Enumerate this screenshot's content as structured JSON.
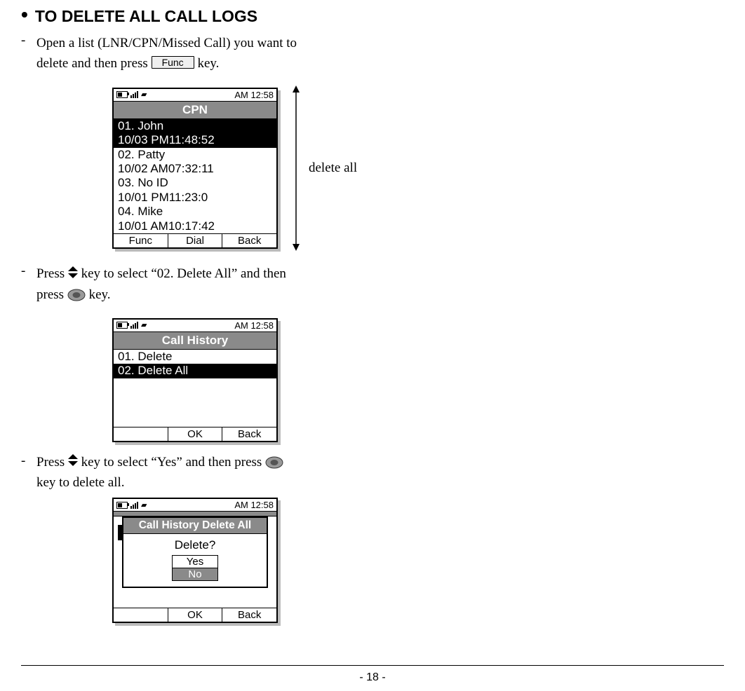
{
  "heading": "TO DELETE ALL CALL LOGS",
  "step1": {
    "line1": "Open a list (LNR/CPN/Missed Call) you want to",
    "line2a": "delete and then press",
    "func_key": "Func",
    "line2b": " key."
  },
  "screen1": {
    "time": "AM 12:58",
    "title": "CPN",
    "entry1_line1": "01. John",
    "entry1_line2": "10/03 PM11:48:52",
    "entry2_line1": "02. Patty",
    "entry2_line2": "10/02 AM07:32:11",
    "entry3_line1": "03. No ID",
    "entry3_line2": "10/01 PM11:23:0",
    "entry4_line1": "04. Mike",
    "entry4_line2": "10/01 AM10:17:42",
    "sk_left": "Func",
    "sk_mid": "Dial",
    "sk_right": "Back",
    "side_label": "delete all"
  },
  "step2": {
    "a": "Press ",
    "b": " key to select “02. Delete All” and then",
    "c": "press  ",
    "d": " key."
  },
  "screen2": {
    "time": "AM 12:58",
    "title": "Call History",
    "item1": "01. Delete",
    "item2": "02. Delete All",
    "sk_mid": "OK",
    "sk_right": "Back"
  },
  "step3": {
    "a": "Press ",
    "b": " key to select “Yes” and then press ",
    "c": "key to delete all."
  },
  "screen3": {
    "time": "AM 12:58",
    "dialog_title": "Call History Delete All",
    "prompt": "Delete?",
    "yes": "Yes",
    "no": "No",
    "sk_mid": "OK",
    "sk_right": "Back"
  },
  "page_number": "- 18 -"
}
